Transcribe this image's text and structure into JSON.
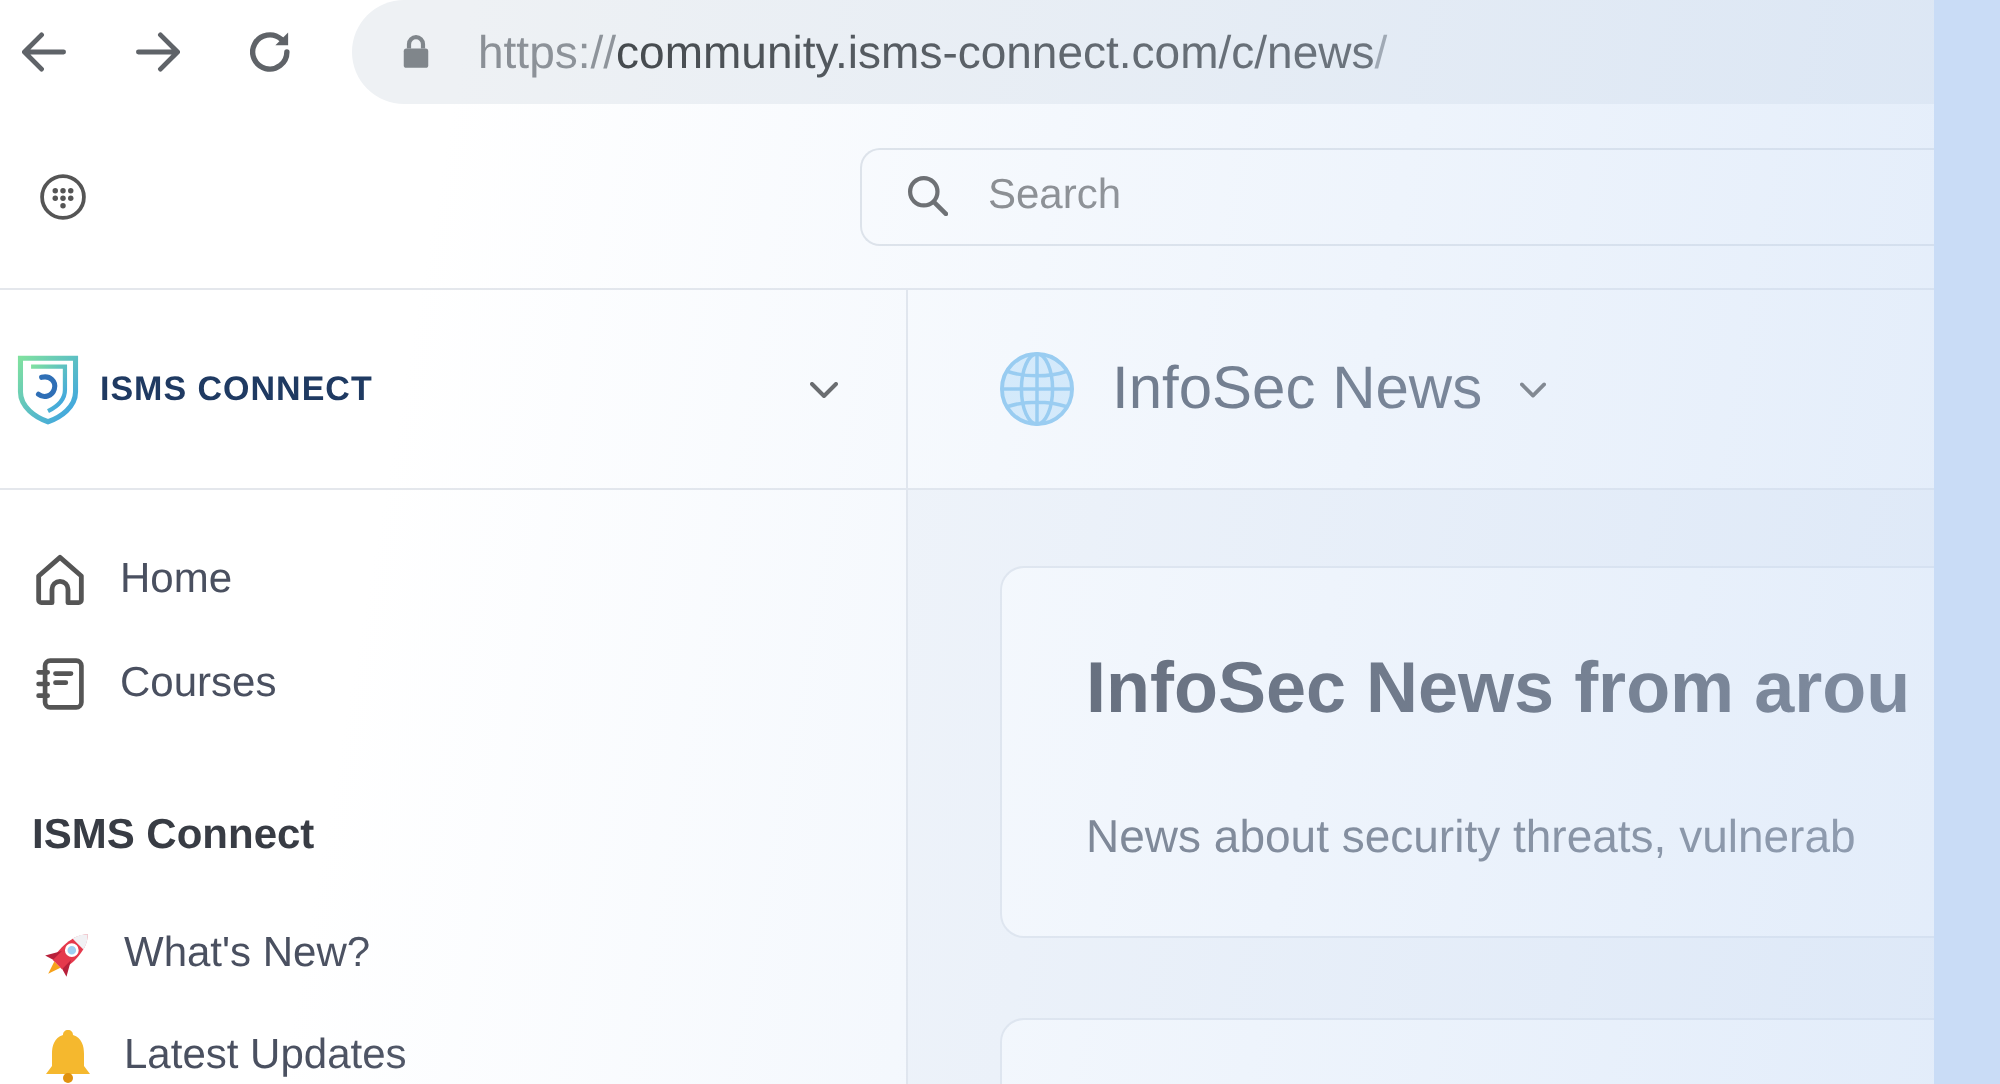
{
  "browser": {
    "url_parts": [
      {
        "text": "https://",
        "dim": true
      },
      {
        "text": "community.isms-connect.com/c/news",
        "dim": false
      },
      {
        "text": "/",
        "dim": true
      }
    ]
  },
  "header": {
    "search": {
      "placeholder": "Search"
    }
  },
  "sidebar": {
    "brand": "ISMS CONNECT",
    "nav": [
      {
        "label": "Home",
        "selected": false
      },
      {
        "label": "Courses",
        "selected": false
      }
    ],
    "sections": [
      {
        "title": "ISMS Connect",
        "items": [
          {
            "label": "What's New?",
            "selected": false
          },
          {
            "label": "Latest Updates",
            "selected": false
          }
        ]
      }
    ]
  },
  "space": {
    "title": "InfoSec News",
    "cards": [
      {
        "kind": "banner",
        "title": "InfoSec News from arou",
        "description": "News about security threats, vulnerab"
      },
      {
        "kind": "post"
      }
    ]
  }
}
